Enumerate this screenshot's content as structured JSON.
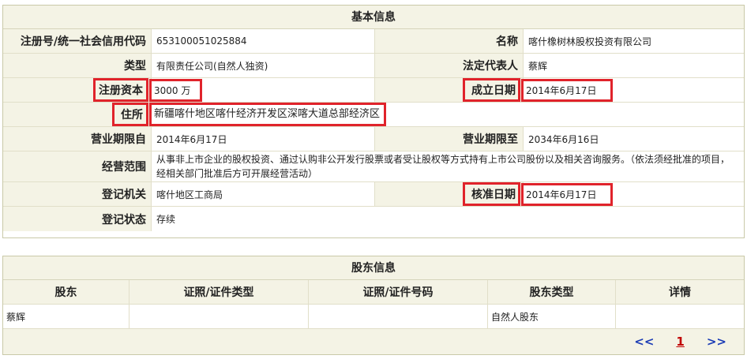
{
  "basic": {
    "title": "基本信息",
    "reg_no_label": "注册号/统一社会信用代码",
    "reg_no": "653100051025884",
    "name_label": "名称",
    "name": "喀什橡树林股权投资有限公司",
    "type_label": "类型",
    "type": "有限责任公司(自然人独资)",
    "legal_rep_label": "法定代表人",
    "legal_rep": "蔡辉",
    "capital_label": "注册资本",
    "capital": "3000 万",
    "founded_label": "成立日期",
    "founded": "2014年6月17日",
    "address_label": "住所",
    "address": "新疆喀什地区喀什经济开发区深喀大道总部经济区",
    "term_from_label": "营业期限自",
    "term_from": "2014年6月17日",
    "term_to_label": "营业期限至",
    "term_to": "2034年6月16日",
    "scope_label": "经营范围",
    "scope": "从事非上市企业的股权投资、通过认购非公开发行股票或者受让股权等方式持有上市公司股份以及相关咨询服务。（依法须经批准的项目，经相关部门批准后方可开展经营活动）",
    "authority_label": "登记机关",
    "authority": "喀什地区工商局",
    "approved_label": "核准日期",
    "approved": "2014年6月17日",
    "status_label": "登记状态",
    "status": "存续"
  },
  "shareholders": {
    "title": "股东信息",
    "columns": [
      "股东",
      "证照/证件类型",
      "证照/证件号码",
      "股东类型",
      "详情"
    ],
    "rows": [
      [
        "蔡辉",
        "",
        "",
        "自然人股东",
        ""
      ]
    ],
    "pager": {
      "prev": "<<",
      "page": "1",
      "next": ">>"
    }
  },
  "colors": {
    "header_bg": "#f4f3e5",
    "highlight": "#e0232b",
    "pager_arrow": "#1a3bb5",
    "pager_page": "#c00000"
  }
}
